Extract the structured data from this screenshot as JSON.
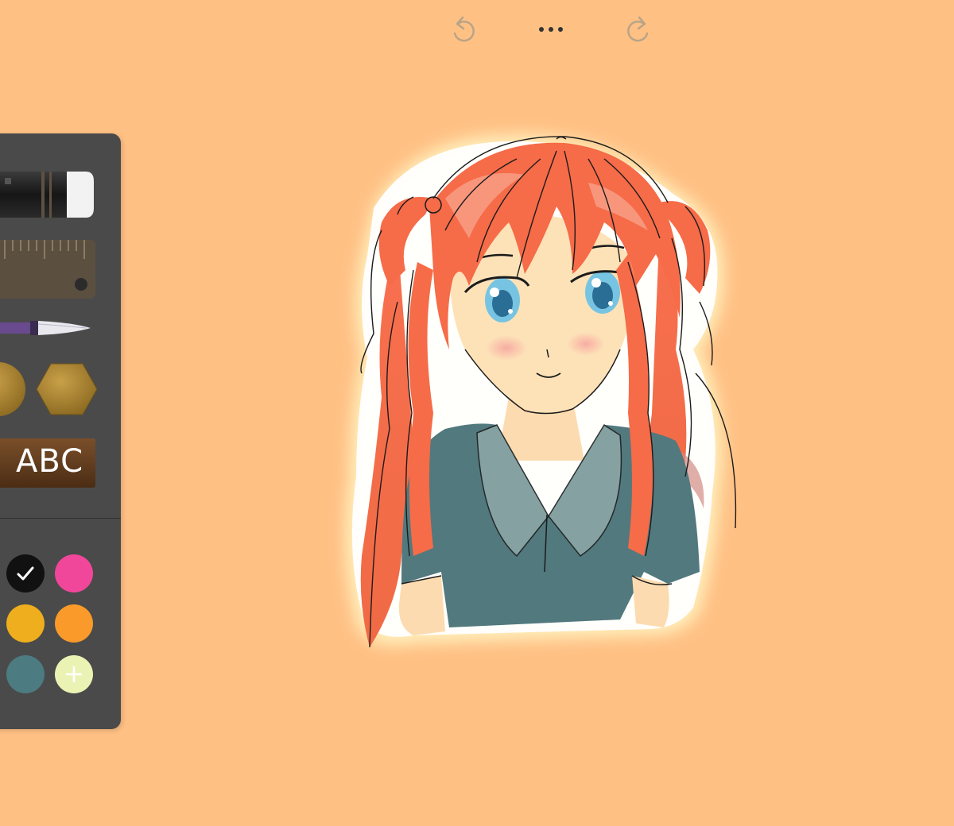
{
  "toolbar": {
    "undo_icon": "undo-icon",
    "more_icon": "more-dots-icon",
    "redo_icon": "redo-icon"
  },
  "tools": [
    {
      "name": "eraser",
      "icon": "eraser-icon"
    },
    {
      "name": "ruler",
      "icon": "ruler-icon"
    },
    {
      "name": "brush",
      "icon": "brush-icon"
    },
    {
      "name": "shapes",
      "icon": "shapes-icon"
    },
    {
      "name": "text",
      "label": "ABC",
      "icon": "text-tool-icon"
    }
  ],
  "colors": {
    "background": "#FFC084",
    "palette_bg": "#4A4A4A",
    "swatches": [
      "#111111",
      "#F0479A",
      "#EFAE1D",
      "#F99A2A",
      "#4C7B82",
      "#EBF3B4"
    ],
    "selected_swatch": "#111111"
  },
  "swatch_icons": {
    "selected": "check-icon",
    "add": "plus-icon"
  }
}
